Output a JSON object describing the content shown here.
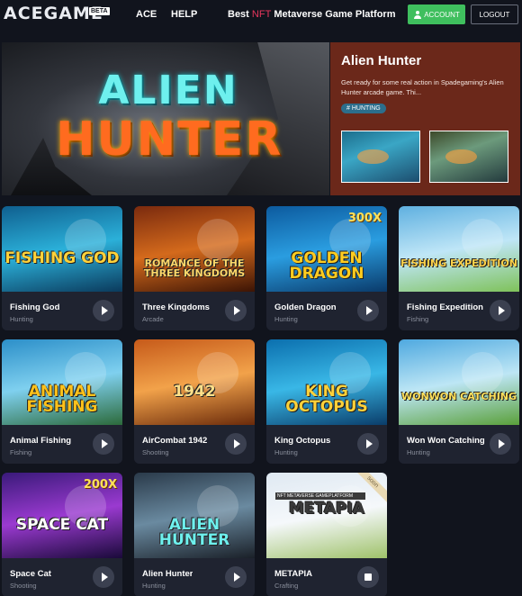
{
  "header": {
    "logo": "ACEGAME",
    "beta": "BETA",
    "nav": [
      "ACE",
      "HELP"
    ],
    "tagline_prefix": "Best",
    "tagline_nft": "NFT",
    "tagline_suffix": "Metaverse Game Platform",
    "account_label": "ACCOUNT",
    "logout_label": "LOGOUT"
  },
  "hero": {
    "art_line1": "ALIEN",
    "art_line2": "HUNTER",
    "title": "Alien Hunter",
    "description": "Get ready for some real action in Spadegaming's Alien Hunter arcade game. Thi...",
    "tag": "# HUNTING"
  },
  "games": [
    {
      "name": "Fishing God",
      "genre": "Hunting",
      "art_text": "FISHING GOD",
      "colors": [
        "#0f5f8f",
        "#2bb0d9",
        "#0b3a5c"
      ],
      "text_color": "#ffd23a"
    },
    {
      "name": "Three Kingdoms",
      "genre": "Arcade",
      "art_text": "ROMANCE OF THE THREE KINGDOMS",
      "colors": [
        "#7a2a0e",
        "#d46a1c",
        "#3c1405"
      ],
      "text_color": "#ffd86a"
    },
    {
      "name": "Golden Dragon",
      "genre": "Hunting",
      "art_text": "GOLDEN DRAGON",
      "badge": "300X",
      "colors": [
        "#0c5a9e",
        "#2a9de0",
        "#0a3a6a"
      ],
      "text_color": "#ffcc1f"
    },
    {
      "name": "Fishing Expedition",
      "genre": "Fishing",
      "art_text": "FISHING EXPEDITION",
      "colors": [
        "#5fb0e0",
        "#bfe6f7",
        "#7fc25a"
      ],
      "text_color": "#ffd24a"
    },
    {
      "name": "Animal Fishing",
      "genre": "Fishing",
      "art_text": "ANIMAL FISHING",
      "colors": [
        "#2c8fc9",
        "#7fd0ef",
        "#2c6a3a"
      ],
      "text_color": "#ffc21a"
    },
    {
      "name": "AirCombat 1942",
      "genre": "Shooting",
      "art_text": "1942",
      "colors": [
        "#c65a1a",
        "#f2a24a",
        "#6a2a0a"
      ],
      "text_color": "#ffe08a"
    },
    {
      "name": "King Octopus",
      "genre": "Hunting",
      "art_text": "KING OCTOPUS",
      "colors": [
        "#0b6fae",
        "#39b7e6",
        "#0a3d6a"
      ],
      "text_color": "#ffd23a"
    },
    {
      "name": "Won Won Catching",
      "genre": "Hunting",
      "art_text": "WONWON CATCHING",
      "colors": [
        "#4fa9e0",
        "#bde6f5",
        "#5aa03a"
      ],
      "text_color": "#ffe05a"
    },
    {
      "name": "Space Cat",
      "genre": "Shooting",
      "art_text": "SPACE CAT",
      "badge": "200X",
      "colors": [
        "#3a1a7a",
        "#9a3ad0",
        "#1a0a3a"
      ],
      "text_color": "#ffffff"
    },
    {
      "name": "Alien Hunter",
      "genre": "Hunting",
      "art_text": "ALIEN HUNTER",
      "colors": [
        "#2a3a4a",
        "#6a8aa0",
        "#1a2028"
      ],
      "text_color": "#6ef0ee"
    },
    {
      "name": "METAPIA",
      "genre": "Crafting",
      "art_text": "METAPIA",
      "banner": "NFT METAVERSE GAMEPLATFORM",
      "soon": "soon",
      "colors": [
        "#dfe9f2",
        "#f5f8fb",
        "#9fc26a"
      ],
      "text_color": "#3a3a3a"
    }
  ],
  "icons": {
    "account": "user-icon",
    "play": "play-icon",
    "stop": "stop-icon"
  },
  "colors": {
    "background": "#11141d",
    "card": "#1f2330",
    "accent_green": "#3fbf5e",
    "hero_panel": "#6b281a",
    "nft_pink": "#e8365d"
  }
}
